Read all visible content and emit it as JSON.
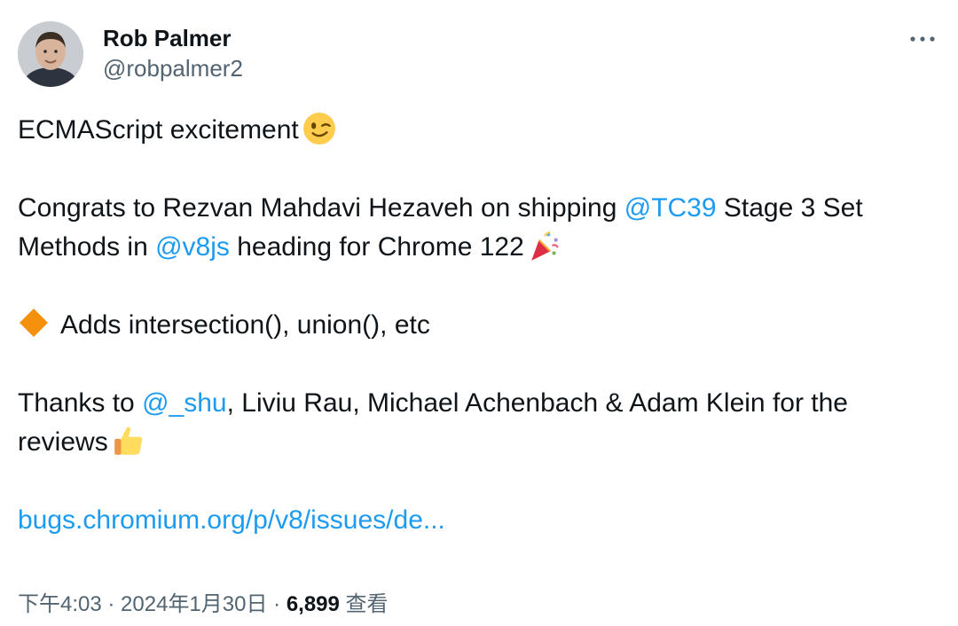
{
  "author": {
    "name": "Rob Palmer",
    "handle": "@robpalmer2"
  },
  "icons": {
    "more": "more-horizontal-icon",
    "wink": "winking-face-emoji",
    "party": "party-popper-emoji",
    "diamond": "orange-diamond-emoji",
    "thumbs": "thumbs-up-emoji"
  },
  "colors": {
    "link": "#1d9bf0",
    "text": "#0f1419",
    "muted": "#536471"
  },
  "tweet": {
    "line1": "ECMAScript excitement",
    "p2_a": "Congrats to Rezvan Mahdavi Hezaveh on shipping ",
    "p2_mention1": "@TC39",
    "p2_b": " Stage 3 Set Methods in ",
    "p2_mention2": "@v8js",
    "p2_c": " heading for Chrome 122",
    "p3": "Adds intersection(), union(), etc",
    "p4_a": "Thanks to ",
    "p4_mention": "@_shu",
    "p4_b": ", Liviu Rau, Michael Achenbach & Adam Klein for the reviews",
    "link": "bugs.chromium.org/p/v8/issues/de..."
  },
  "meta": {
    "time": "下午4:03",
    "sep1": " · ",
    "date": "2024年1月30日",
    "sep2": " · ",
    "views": "6,899",
    "views_label": " 查看"
  }
}
